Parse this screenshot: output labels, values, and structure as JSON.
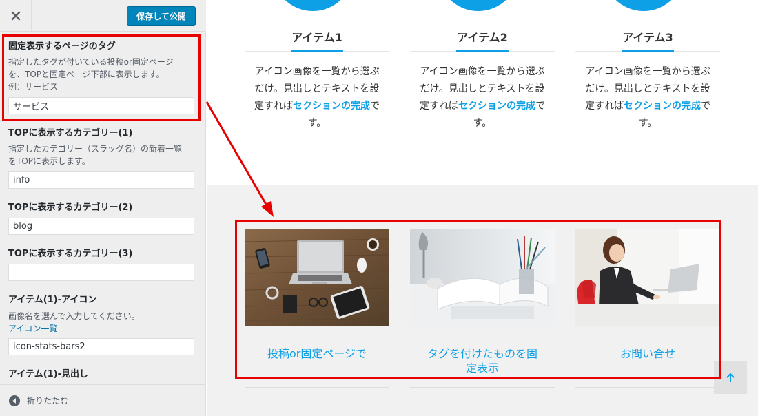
{
  "sidebar": {
    "save_label": "保存して公開",
    "fields": [
      {
        "title": "固定表示するページのタグ",
        "description": [
          "指定したタグが付いている投稿or固定ページ",
          "を、TOPと固定ページ下部に表示します。",
          "例：サービス"
        ],
        "value": "サービス"
      },
      {
        "title": "TOPに表示するカテゴリー(1)",
        "description": [
          "指定したカテゴリー（スラッグ名）の新着一覧",
          "をTOPに表示します。"
        ],
        "value": "info"
      },
      {
        "title": "TOPに表示するカテゴリー(2)",
        "value": "blog"
      },
      {
        "title": "TOPに表示するカテゴリー(3)",
        "value": ""
      },
      {
        "title": "アイテム(1)-アイコン",
        "description": [
          "画像名を選んで入力してください。"
        ],
        "link": "アイコン一覧",
        "value": "icon-stats-bars2"
      },
      {
        "title": "アイテム(1)-見出し"
      }
    ],
    "collapse_label": "折りたたむ"
  },
  "preview": {
    "items": [
      {
        "title": "アイテム1",
        "text_line1": "アイコン画像を一覧から選ぶ",
        "text_line2": "だけ。見出しとテキストを設",
        "text_pre": "定すれば",
        "text_highlight": "セクションの完成",
        "text_post": "で",
        "text_line4": "す。"
      },
      {
        "title": "アイテム2",
        "text_line1": "アイコン画像を一覧から選ぶ",
        "text_line2": "だけ。見出しとテキストを設",
        "text_pre": "定すれば",
        "text_highlight": "セクションの完成",
        "text_post": "で",
        "text_line4": "す。"
      },
      {
        "title": "アイテム3",
        "text_line1": "アイコン画像を一覧から選ぶ",
        "text_line2": "だけ。見出しとテキストを設",
        "text_pre": "定すれば",
        "text_highlight": "セクションの完成",
        "text_post": "で",
        "text_line4": "す。"
      }
    ],
    "cards": [
      {
        "title_line1": "投稿or固定ページで",
        "title_line2": ""
      },
      {
        "title_line1": "タグを付けたものを固",
        "title_line2": "定表示"
      },
      {
        "title_line1": "お問い合せ",
        "title_line2": ""
      }
    ]
  },
  "icons": {
    "close": "close-icon",
    "collapse": "arrow-left-circle-icon",
    "to_top": "arrow-up-icon"
  },
  "colors": {
    "accent": "#0ea0e6",
    "save_button": "#0085ba",
    "annotation": "#e60000"
  }
}
